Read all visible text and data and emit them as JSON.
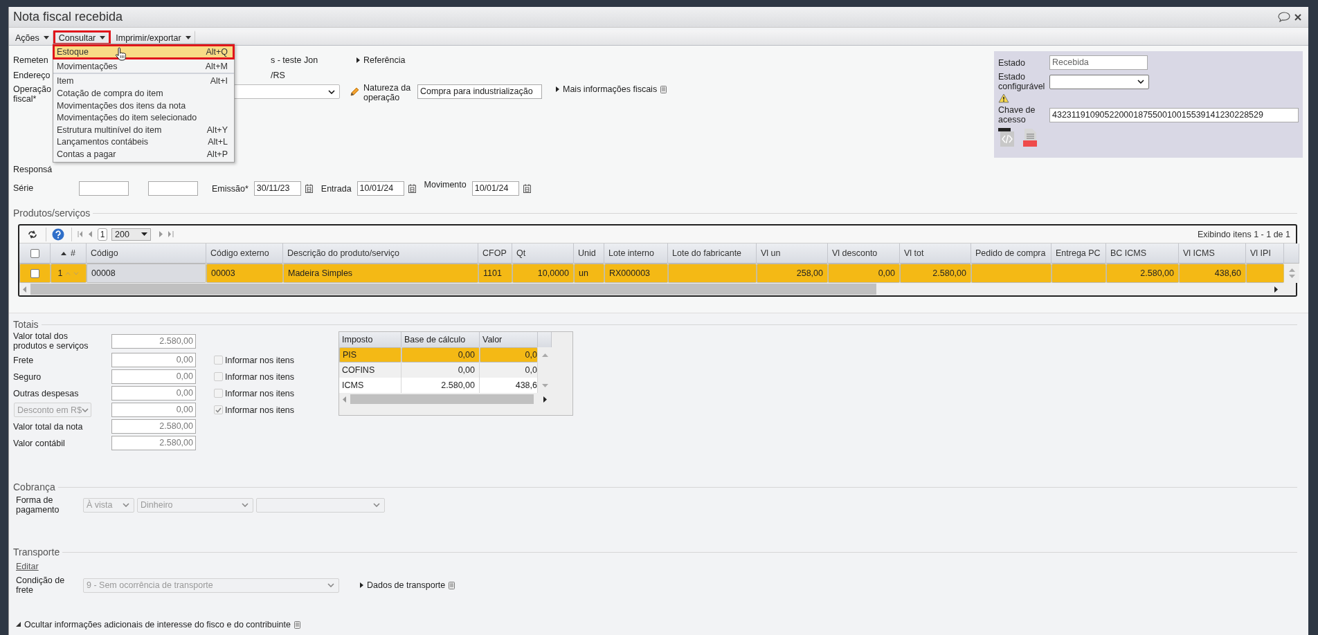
{
  "window": {
    "title": "Nota fiscal recebida"
  },
  "toolbar": [
    {
      "label": "Ações",
      "selected": false
    },
    {
      "label": "Consultar",
      "selected": true
    },
    {
      "label": "Imprimir/exportar",
      "selected": false
    }
  ],
  "menu": {
    "sections": [
      {
        "items": [
          {
            "label": "Estoque",
            "shortcut": "Alt+Q",
            "selected": true
          },
          {
            "label": "Movimentações",
            "shortcut": "Alt+M",
            "selected": false
          }
        ]
      },
      {
        "items": [
          {
            "label": "Item",
            "shortcut": "Alt+I",
            "selected": false
          },
          {
            "label": "Cotação de compra do item",
            "selected": false
          },
          {
            "label": "Movimentações dos itens da nota",
            "selected": false
          },
          {
            "label": "Movimentações do item selecionado",
            "selected": false
          },
          {
            "label": "Estrutura multinível do item",
            "shortcut": "Alt+Y",
            "selected": false
          },
          {
            "label": "Lançamentos contábeis",
            "shortcut": "Alt+L",
            "selected": false
          },
          {
            "label": "Contas a pagar",
            "shortcut": "Alt+P",
            "selected": false
          }
        ]
      }
    ]
  },
  "header": {
    "sender": {
      "label": "Remeten",
      "value": "s - teste Jon"
    },
    "reference": "Referência",
    "address": {
      "label": "Endereço",
      "value": "/RS"
    },
    "operation": {
      "label": "Operação fiscal*"
    },
    "nature": {
      "label": "Natureza da operação",
      "value": "Compra para industrialização"
    },
    "more_fiscal_info": "Mais informações fiscais",
    "responsible": {
      "label": "Responsá"
    },
    "series": {
      "label": "Série"
    },
    "dates": [
      {
        "label": "Emissão*",
        "value": "30/11/23"
      },
      {
        "label": "Entrada",
        "value": "10/01/24"
      },
      {
        "label": "Movimento",
        "value": "10/01/24"
      }
    ]
  },
  "status_panel": {
    "state": {
      "label": "Estado",
      "value": "Recebida"
    },
    "configurable_state": {
      "label": "Estado configurável"
    },
    "access_key": {
      "label": "Chave de acesso",
      "value": "43231191090522000187550010015539141230228529"
    }
  },
  "products": {
    "title": "Produtos/serviços",
    "all_checked": false,
    "page": "1",
    "page_size": "200",
    "summary": "Exibindo itens 1 - 1 de 1",
    "columns": [
      {
        "label": "#",
        "kind": "sort"
      },
      {
        "label": "Código",
        "kind": "shaded"
      },
      {
        "label": "Código externo",
        "kind": "text"
      },
      {
        "label": "Descrição do produto/serviço",
        "kind": "text"
      },
      {
        "label": "CFOP",
        "kind": "text"
      },
      {
        "label": "Qt",
        "kind": "number"
      },
      {
        "label": "Unid",
        "kind": "text"
      },
      {
        "label": "Lote interno",
        "kind": "text"
      },
      {
        "label": "Lote do fabricante",
        "kind": "text"
      },
      {
        "label": "Vl un",
        "kind": "number"
      },
      {
        "label": "Vl desconto",
        "kind": "number"
      },
      {
        "label": "Vl tot",
        "kind": "number"
      },
      {
        "label": "Pedido de compra",
        "kind": "text"
      },
      {
        "label": "Entrega PC",
        "kind": "text"
      },
      {
        "label": "BC ICMS",
        "kind": "number"
      },
      {
        "label": "Vl ICMS",
        "kind": "number"
      },
      {
        "label": "Vl IPI",
        "kind": "number"
      }
    ],
    "rows": [
      {
        "selected": true,
        "checked": false,
        "cells": [
          "1",
          "00008",
          "00003",
          "Madeira Simples",
          "1101",
          "10,0000",
          "un",
          "RX000003",
          null,
          "258,00",
          "0,00",
          "2.580,00",
          null,
          null,
          "2.580,00",
          "438,60",
          null
        ]
      }
    ]
  },
  "totals": {
    "title": "Totais",
    "rows": [
      {
        "label": "Valor total dos produtos e serviços",
        "value": "2.580,00"
      },
      {
        "label": "Frete",
        "value": "0,00",
        "option": {
          "label": "Informar nos itens",
          "checked": false,
          "disabled": true
        }
      },
      {
        "label": "Seguro",
        "value": "0,00",
        "option": {
          "label": "Informar nos itens",
          "checked": false,
          "disabled": true
        }
      },
      {
        "label": "Outras despesas",
        "value": "0,00",
        "option": {
          "label": "Informar nos itens",
          "checked": false,
          "disabled": true
        }
      },
      {
        "kind": "select",
        "label": "Desconto em R$",
        "value": "0,00",
        "option": {
          "label": "Informar nos itens",
          "checked": true,
          "disabled": true
        }
      },
      {
        "label": "Valor total da nota",
        "value": "2.580,00"
      },
      {
        "label": "Valor contábil",
        "value": "2.580,00"
      }
    ],
    "taxes": {
      "columns": [
        "Imposto",
        "Base de cálculo",
        "Valor"
      ],
      "rows": [
        {
          "selected": true,
          "cells": [
            "PIS",
            "0,00",
            "0,0"
          ]
        },
        {
          "selected": false,
          "cells": [
            "COFINS",
            "0,00",
            "0,0"
          ]
        },
        {
          "selected": false,
          "cells": [
            "ICMS",
            "2.580,00",
            "438,6"
          ]
        }
      ]
    }
  },
  "billing": {
    "title": "Cobrança",
    "label": "Forma de pagamento",
    "fields": [
      {
        "value": "À vista",
        "disabled": true
      },
      {
        "value": "Dinheiro",
        "disabled": true
      },
      {
        "disabled": true
      }
    ]
  },
  "transport": {
    "title": "Transporte",
    "edit_link": "Editar",
    "freight": {
      "label": "Condição de frete",
      "value": "9 - Sem ocorrência de transporte",
      "disabled": true
    },
    "details": "Dados de transporte"
  },
  "footer": {
    "label": "Ocultar informações adicionais de interesse do fisco e do contribuinte",
    "expanded": true
  }
}
